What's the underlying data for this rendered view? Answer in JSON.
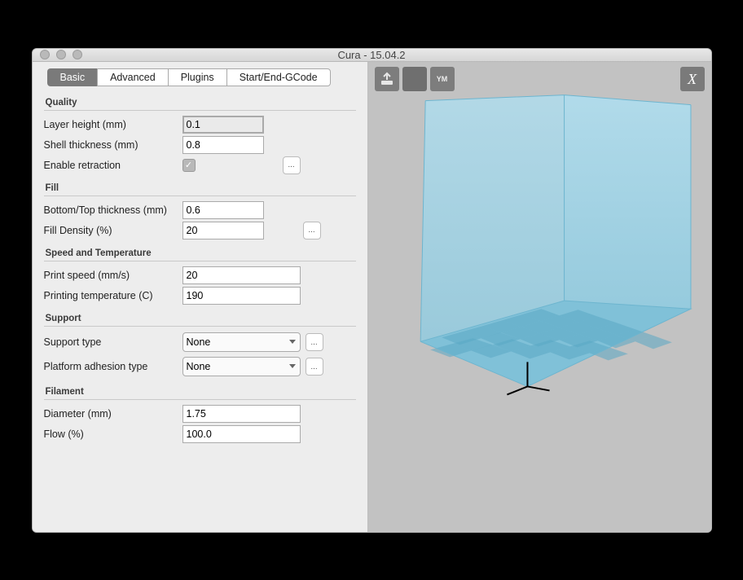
{
  "window": {
    "title": "Cura - 15.04.2"
  },
  "tabs": [
    "Basic",
    "Advanced",
    "Plugins",
    "Start/End-GCode"
  ],
  "sections": {
    "quality": {
      "title": "Quality",
      "layer_height": {
        "label": "Layer height (mm)",
        "value": "0.1"
      },
      "shell_thickness": {
        "label": "Shell thickness (mm)",
        "value": "0.8"
      },
      "enable_retraction": {
        "label": "Enable retraction",
        "checked": true
      }
    },
    "fill": {
      "title": "Fill",
      "bottom_top": {
        "label": "Bottom/Top thickness (mm)",
        "value": "0.6"
      },
      "fill_density": {
        "label": "Fill Density (%)",
        "value": "20"
      }
    },
    "speed_temp": {
      "title": "Speed and Temperature",
      "print_speed": {
        "label": "Print speed (mm/s)",
        "value": "20"
      },
      "print_temp": {
        "label": "Printing temperature (C)",
        "value": "190"
      }
    },
    "support": {
      "title": "Support",
      "support_type": {
        "label": "Support type",
        "value": "None"
      },
      "adhesion_type": {
        "label": "Platform adhesion type",
        "value": "None"
      }
    },
    "filament": {
      "title": "Filament",
      "diameter": {
        "label": "Diameter (mm)",
        "value": "1.75"
      },
      "flow": {
        "label": "Flow (%)",
        "value": "100.0"
      }
    }
  },
  "toolbar": {
    "ym_label": "YM"
  },
  "ellipsis": "..."
}
